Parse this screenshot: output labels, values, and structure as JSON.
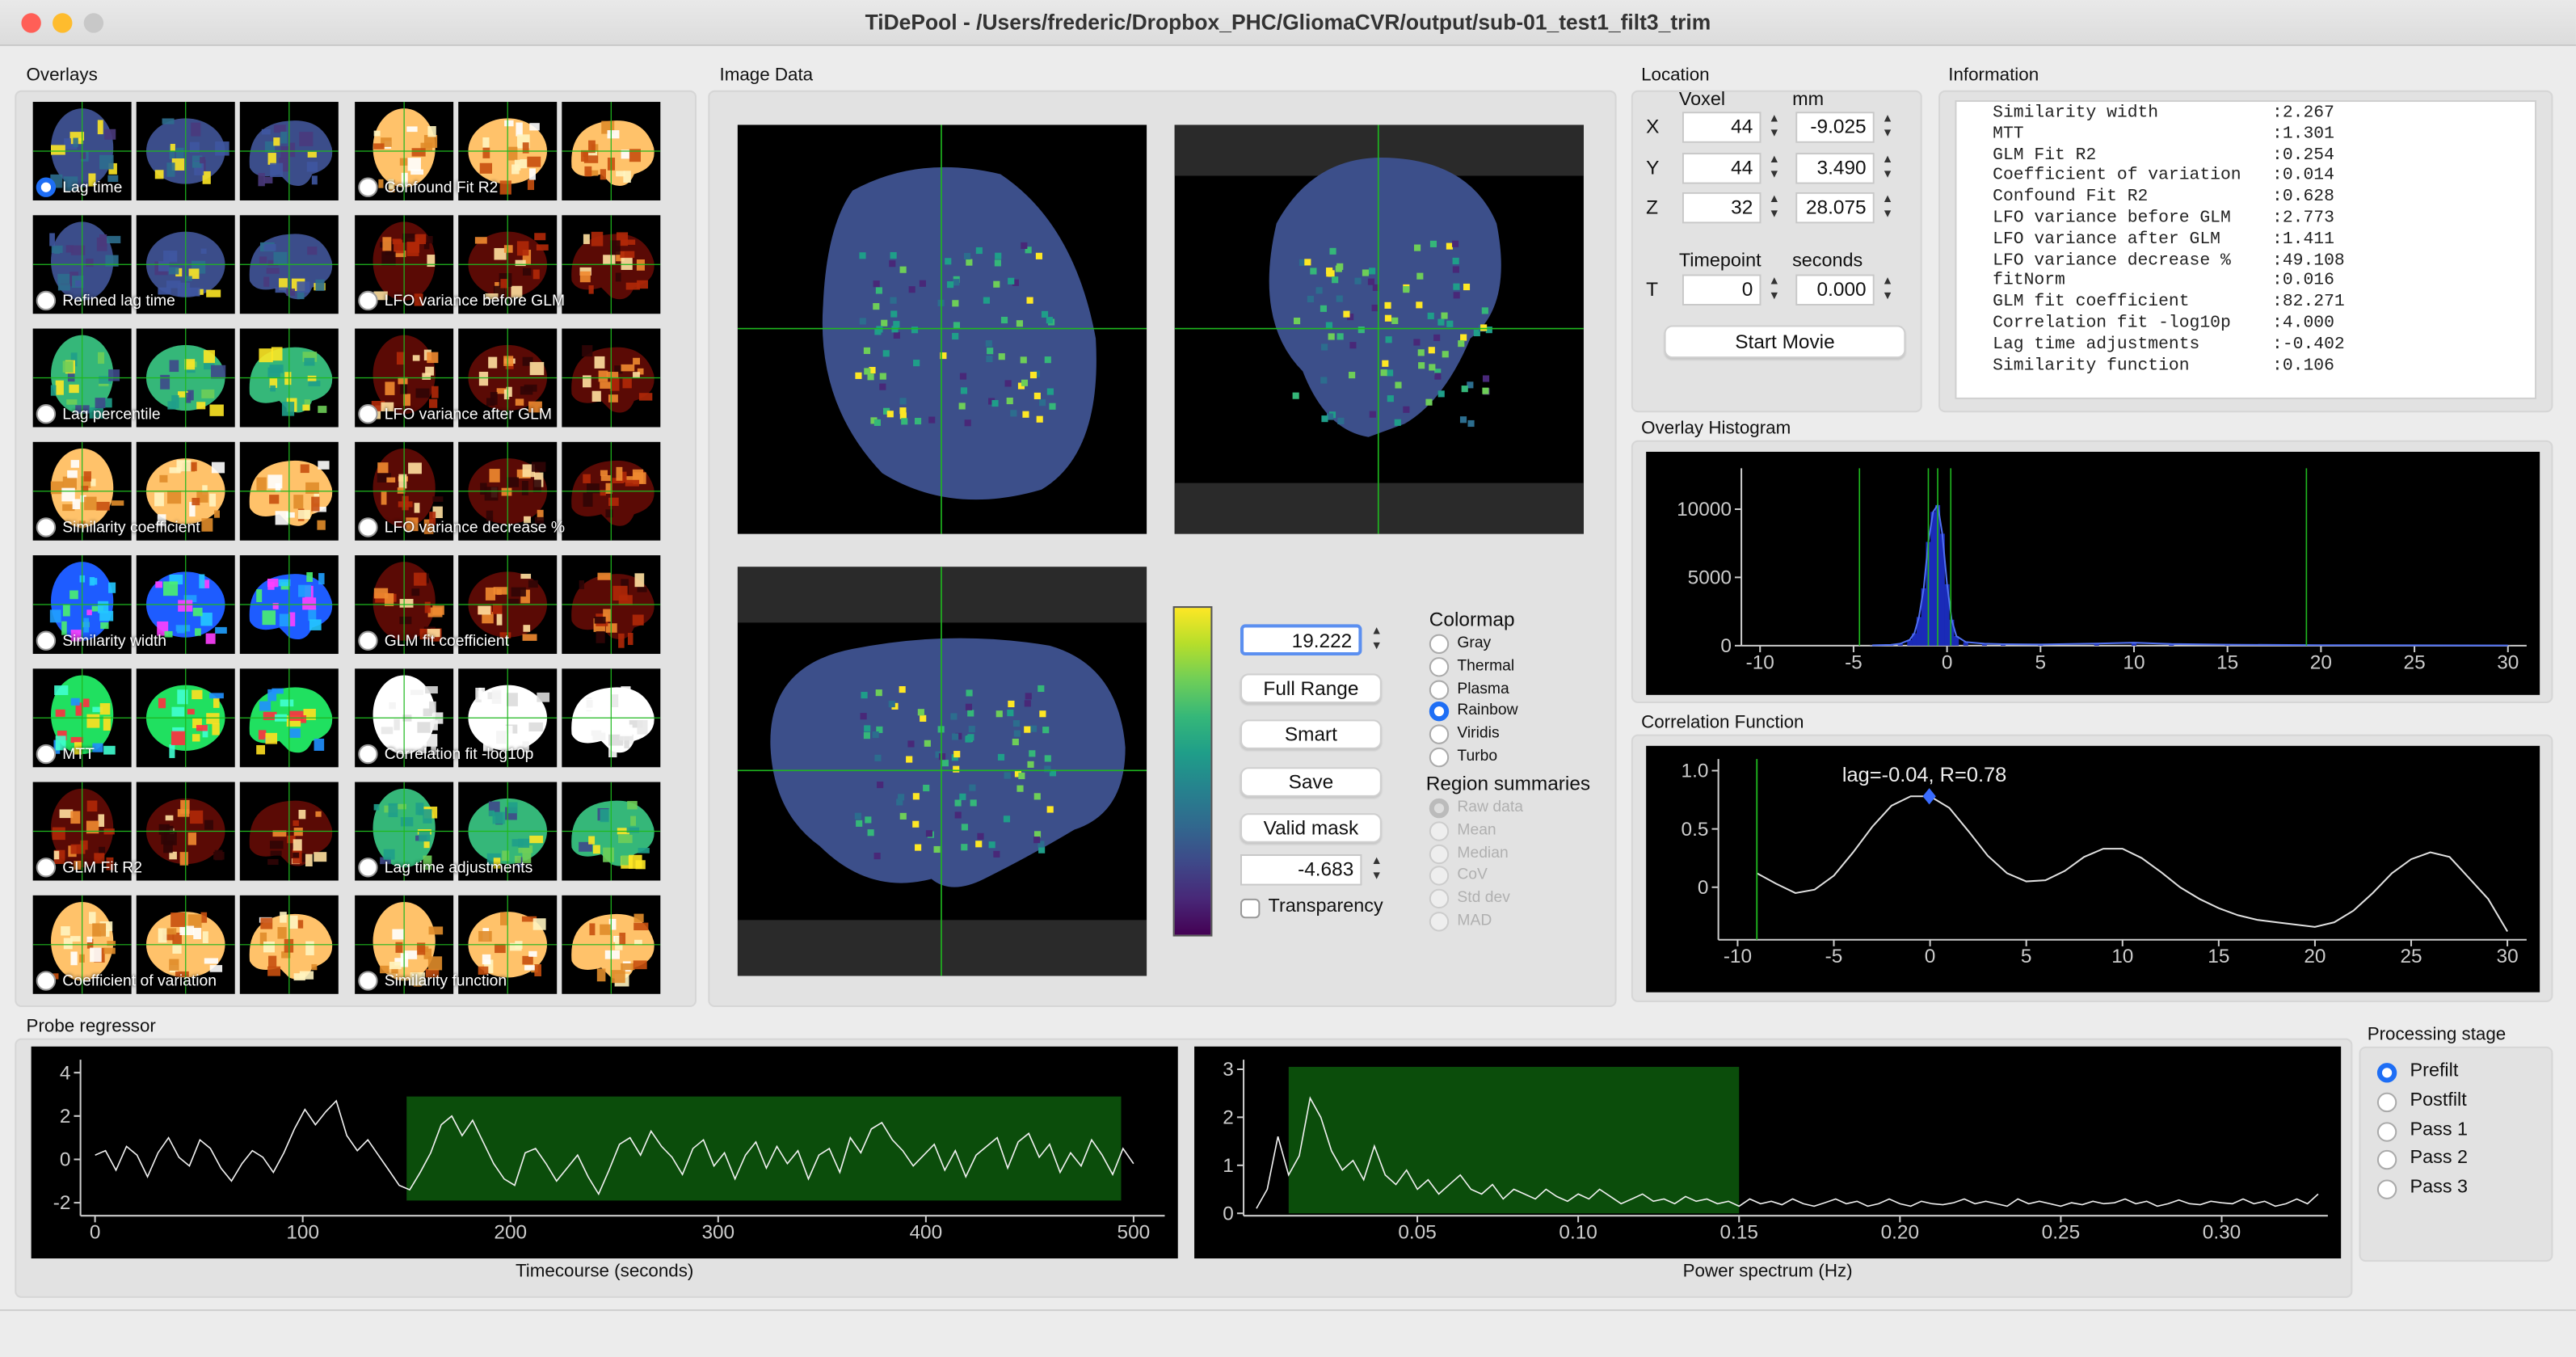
{
  "window": {
    "title": "TiDePool - /Users/frederic/Dropbox_PHC/GliomaCVR/output/sub-01_test1_filt3_trim"
  },
  "overlays": {
    "label": "Overlays",
    "items": [
      {
        "label": "Lag time",
        "selected": true,
        "palette": "viridis"
      },
      {
        "label": "Confound Fit R2",
        "selected": false,
        "palette": "hot"
      },
      {
        "label": "Refined lag time",
        "selected": false,
        "palette": "viridis"
      },
      {
        "label": "LFO variance before GLM",
        "selected": false,
        "palette": "hotdark"
      },
      {
        "label": "Lag percentile",
        "selected": false,
        "palette": "viridisbright"
      },
      {
        "label": "LFO variance after GLM",
        "selected": false,
        "palette": "hotdark"
      },
      {
        "label": "Similarity coefficient",
        "selected": false,
        "palette": "hot"
      },
      {
        "label": "LFO variance decrease %",
        "selected": false,
        "palette": "hotdark"
      },
      {
        "label": "Similarity width",
        "selected": false,
        "palette": "rainbow"
      },
      {
        "label": "GLM fit coefficient",
        "selected": false,
        "palette": "hotdark"
      },
      {
        "label": "MTT",
        "selected": false,
        "palette": "rainbow2"
      },
      {
        "label": "Correlation fit -log10p",
        "selected": false,
        "palette": "white"
      },
      {
        "label": "GLM Fit R2",
        "selected": false,
        "palette": "hotdark"
      },
      {
        "label": "Lag time adjustments",
        "selected": false,
        "palette": "viridisbright"
      },
      {
        "label": "Coefficient of variation",
        "selected": false,
        "palette": "hot"
      },
      {
        "label": "Similarity function",
        "selected": false,
        "palette": "hot"
      }
    ]
  },
  "image_data": {
    "label": "Image Data"
  },
  "controls": {
    "max_value": "19.222",
    "min_value": "-4.683",
    "full_range": "Full Range",
    "smart": "Smart",
    "save": "Save",
    "valid_mask": "Valid mask",
    "transparency": "Transparency"
  },
  "colormap": {
    "label": "Colormap",
    "options": [
      {
        "label": "Gray",
        "on": false
      },
      {
        "label": "Thermal",
        "on": false
      },
      {
        "label": "Plasma",
        "on": false
      },
      {
        "label": "Rainbow",
        "on": true
      },
      {
        "label": "Viridis",
        "on": false
      },
      {
        "label": "Turbo",
        "on": false
      }
    ]
  },
  "region_summaries": {
    "label": "Region summaries",
    "options": [
      {
        "label": "Raw data",
        "on": true
      },
      {
        "label": "Mean",
        "on": false
      },
      {
        "label": "Median",
        "on": false
      },
      {
        "label": "CoV",
        "on": false
      },
      {
        "label": "Std dev",
        "on": false
      },
      {
        "label": "MAD",
        "on": false
      }
    ]
  },
  "location": {
    "label": "Location",
    "voxel_header": "Voxel",
    "mm_header": "mm",
    "rows": [
      {
        "axis": "X",
        "voxel": "44",
        "mm": "-9.025"
      },
      {
        "axis": "Y",
        "voxel": "44",
        "mm": "3.490"
      },
      {
        "axis": "Z",
        "voxel": "32",
        "mm": "28.075"
      }
    ],
    "timepoint_header": "Timepoint",
    "seconds_header": "seconds",
    "t_axis": "T",
    "t_value": "0",
    "seconds_value": "0.000",
    "start_movie": "Start Movie"
  },
  "information": {
    "label": "Information",
    "lines": [
      "Similarity width           :2.267",
      "MTT                        :1.301",
      "GLM Fit R2                 :0.254",
      "Coefficient of variation   :0.014",
      "Confound Fit R2            :0.628",
      "LFO variance before GLM    :2.773",
      "LFO variance after GLM     :1.411",
      "LFO variance decrease %    :49.108",
      "fitNorm                    :0.016",
      "GLM fit coefficient        :82.271",
      "Correlation fit -log10p    :4.000",
      "Lag time adjustments       :-0.402",
      "Similarity function        :0.106"
    ]
  },
  "overlay_histogram": {
    "label": "Overlay Histogram",
    "chart_data": {
      "type": "bar",
      "x_ticks": [
        "-10",
        "-5",
        "0",
        "5",
        "10",
        "15",
        "20",
        "25",
        "30"
      ],
      "y_ticks": [
        "0",
        "5000",
        "10000"
      ],
      "xlim": [
        -11,
        31
      ],
      "ylim": [
        0,
        13000
      ],
      "bins": [
        [
          -4,
          20
        ],
        [
          -3,
          60
        ],
        [
          -2.5,
          150
        ],
        [
          -2,
          420
        ],
        [
          -1.75,
          900
        ],
        [
          -1.5,
          2100
        ],
        [
          -1.25,
          4200
        ],
        [
          -1,
          7600
        ],
        [
          -0.75,
          9800
        ],
        [
          -0.5,
          10300
        ],
        [
          -0.25,
          8200
        ],
        [
          0,
          4500
        ],
        [
          0.25,
          1900
        ],
        [
          0.5,
          700
        ],
        [
          1,
          260
        ],
        [
          2,
          150
        ],
        [
          3,
          110
        ],
        [
          5,
          90
        ],
        [
          8,
          160
        ],
        [
          10,
          220
        ],
        [
          12,
          120
        ],
        [
          15,
          70
        ],
        [
          20,
          40
        ],
        [
          25,
          20
        ],
        [
          30,
          10
        ]
      ],
      "markers": [
        -4.683,
        -1.0,
        -0.5,
        0.2,
        19.222
      ]
    }
  },
  "correlation_function": {
    "label": "Correlation Function",
    "annotation": "lag=-0.04, R=0.78",
    "chart_data": {
      "type": "line",
      "x_ticks": [
        "-10",
        "-5",
        "0",
        "5",
        "10",
        "15",
        "20",
        "25",
        "30"
      ],
      "y_ticks": [
        "0",
        "0.5",
        "1.0"
      ],
      "xlim": [
        -11,
        31
      ],
      "ylim": [
        -0.45,
        1.1
      ],
      "x": [
        -9,
        -8,
        -7,
        -6,
        -5,
        -4,
        -3,
        -2,
        -1,
        0,
        1,
        2,
        3,
        4,
        5,
        6,
        7,
        8,
        9,
        10,
        11,
        12,
        13,
        14,
        15,
        16,
        17,
        18,
        19,
        20,
        21,
        22,
        23,
        24,
        25,
        26,
        27,
        28,
        29,
        30
      ],
      "y": [
        0.12,
        0.03,
        -0.05,
        -0.02,
        0.1,
        0.3,
        0.52,
        0.7,
        0.78,
        0.78,
        0.68,
        0.48,
        0.27,
        0.12,
        0.05,
        0.06,
        0.14,
        0.26,
        0.33,
        0.33,
        0.25,
        0.13,
        0.0,
        -0.1,
        -0.18,
        -0.24,
        -0.28,
        -0.3,
        -0.32,
        -0.34,
        -0.3,
        -0.2,
        -0.05,
        0.12,
        0.24,
        0.3,
        0.26,
        0.08,
        -0.1,
        -0.38
      ],
      "marker_x": -9.0,
      "peak": [
        -0.04,
        0.78
      ]
    }
  },
  "probe_regressor": {
    "label": "Probe regressor",
    "timecourse": {
      "caption": "Timecourse (seconds)",
      "chart_data": {
        "type": "line",
        "x_ticks": [
          "0",
          "100",
          "200",
          "300",
          "400",
          "500"
        ],
        "y_ticks": [
          "-2",
          "0",
          "2",
          "4"
        ],
        "xlim": [
          -7,
          515
        ],
        "ylim": [
          -2.6,
          4.6
        ],
        "window": [
          150,
          494
        ],
        "y": [
          0.2,
          0.4,
          -0.5,
          0.6,
          0.2,
          -0.8,
          0.3,
          1.0,
          0.1,
          -0.3,
          0.9,
          0.5,
          -0.4,
          -1.0,
          -0.2,
          0.4,
          0.1,
          -0.6,
          0.3,
          1.4,
          2.3,
          1.6,
          2.2,
          2.7,
          1.1,
          0.4,
          0.9,
          0.2,
          -0.5,
          -1.2,
          -1.4,
          -0.6,
          0.3,
          1.6,
          2.0,
          1.1,
          1.8,
          0.8,
          -0.2,
          -0.9,
          -1.2,
          0.3,
          0.5,
          -0.2,
          -1.0,
          -0.4,
          0.2,
          -0.8,
          -1.6,
          -0.5,
          0.7,
          1.0,
          0.2,
          1.3,
          0.6,
          0.1,
          -0.7,
          0.5,
          0.9,
          -0.3,
          0.3,
          -0.9,
          0.2,
          0.8,
          -0.4,
          0.6,
          -0.2,
          0.4,
          -0.9,
          0.2,
          0.5,
          -0.6,
          1.0,
          0.3,
          1.4,
          1.7,
          0.9,
          0.4,
          -0.3,
          0.2,
          0.7,
          -0.5,
          0.4,
          -0.8,
          0.2,
          0.6,
          1.0,
          -0.4,
          0.8,
          1.2,
          0.1,
          0.7,
          -0.6,
          0.3,
          -0.3,
          0.9,
          0.2,
          -0.7,
          0.5,
          -0.2
        ]
      }
    },
    "power": {
      "caption": "Power spectrum (Hz)",
      "chart_data": {
        "type": "line",
        "x_ticks": [
          "0.05",
          "0.10",
          "0.15",
          "0.20",
          "0.25",
          "0.30"
        ],
        "y_ticks": [
          "0",
          "1",
          "2",
          "3"
        ],
        "xlim": [
          -0.004,
          0.333
        ],
        "ylim": [
          -0.05,
          3.2
        ],
        "window": [
          0.01,
          0.15
        ],
        "y": [
          0.1,
          0.5,
          1.6,
          0.8,
          1.2,
          2.4,
          2.0,
          1.3,
          0.9,
          1.1,
          0.7,
          1.4,
          0.8,
          0.6,
          0.9,
          0.5,
          0.7,
          0.4,
          0.6,
          0.8,
          0.5,
          0.4,
          0.6,
          0.3,
          0.5,
          0.4,
          0.3,
          0.5,
          0.35,
          0.25,
          0.4,
          0.3,
          0.5,
          0.35,
          0.2,
          0.3,
          0.4,
          0.25,
          0.3,
          0.2,
          0.35,
          0.25,
          0.3,
          0.2,
          0.25,
          0.15,
          0.3,
          0.2,
          0.25,
          0.18,
          0.3,
          0.2,
          0.15,
          0.22,
          0.3,
          0.2,
          0.25,
          0.15,
          0.2,
          0.3,
          0.2,
          0.15,
          0.25,
          0.2,
          0.18,
          0.22,
          0.3,
          0.2,
          0.25,
          0.2,
          0.15,
          0.3,
          0.2,
          0.25,
          0.2,
          0.15,
          0.22,
          0.18,
          0.25,
          0.2,
          0.22,
          0.3,
          0.2,
          0.25,
          0.15,
          0.2,
          0.28,
          0.2,
          0.18,
          0.25,
          0.22,
          0.2,
          0.3,
          0.2,
          0.25,
          0.15,
          0.2,
          0.3,
          0.2,
          0.4
        ]
      }
    }
  },
  "processing_stage": {
    "label": "Processing stage",
    "options": [
      {
        "label": "Prefilt",
        "on": true
      },
      {
        "label": "Postfilt",
        "on": false
      },
      {
        "label": "Pass 1",
        "on": false
      },
      {
        "label": "Pass 2",
        "on": false
      },
      {
        "label": "Pass 3",
        "on": false
      }
    ]
  },
  "colors": {
    "accent": "#1e6ef5",
    "crosshair": "#1fb81f",
    "roi": "#0b4d0b"
  }
}
